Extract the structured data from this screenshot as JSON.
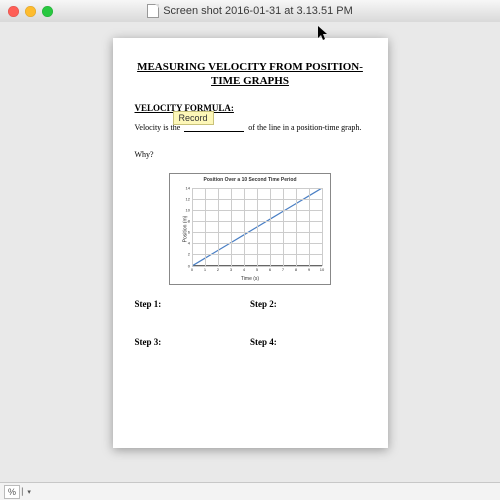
{
  "window": {
    "title": "Screen shot 2016-01-31 at 3.13.51 PM"
  },
  "tooltip": "Record",
  "doc": {
    "title": "MEASURING VELOCITY FROM POSITION-TIME GRAPHS",
    "section": "VELOCITY FORMULA:",
    "sentence_pre": "Velocity is the",
    "sentence_post": "of the line in a position-time graph.",
    "why": "Why?",
    "steps": [
      "Step 1:",
      "Step 2:",
      "Step 3:",
      "Step 4:"
    ]
  },
  "chart_data": {
    "type": "line",
    "title": "Position Over a 10 Second Time Period",
    "xlabel": "Time (s)",
    "ylabel": "Position (m)",
    "x": [
      0,
      1,
      2,
      3,
      4,
      5,
      6,
      7,
      8,
      9,
      10
    ],
    "values": [
      0,
      1.4,
      2.8,
      4.2,
      5.6,
      7,
      8.4,
      9.8,
      11.2,
      12.6,
      14
    ],
    "xlim": [
      0,
      10
    ],
    "ylim": [
      0,
      14
    ],
    "xticks": [
      0,
      1,
      2,
      3,
      4,
      5,
      6,
      7,
      8,
      9,
      10
    ],
    "yticks": [
      0,
      2,
      4,
      6,
      8,
      10,
      12,
      14
    ]
  },
  "status": {
    "zoom": "%"
  }
}
